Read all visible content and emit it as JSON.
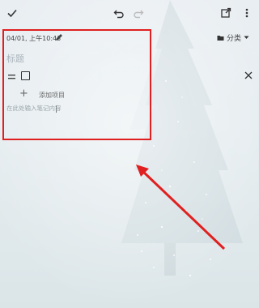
{
  "toolbar": {
    "confirm_icon": "check-icon",
    "undo_icon": "undo-icon",
    "redo_icon": "redo-icon",
    "share_icon": "share-icon",
    "more_icon": "more-vert-icon"
  },
  "note": {
    "date": "04/01, 上午10:43",
    "category_label": "分类",
    "title_placeholder": "标题",
    "add_item_label": "添加项目",
    "content_placeholder": "在此处输入笔记内容"
  },
  "colors": {
    "annotation": "#e02020",
    "text": "#333333",
    "placeholder": "#aab4bb"
  }
}
